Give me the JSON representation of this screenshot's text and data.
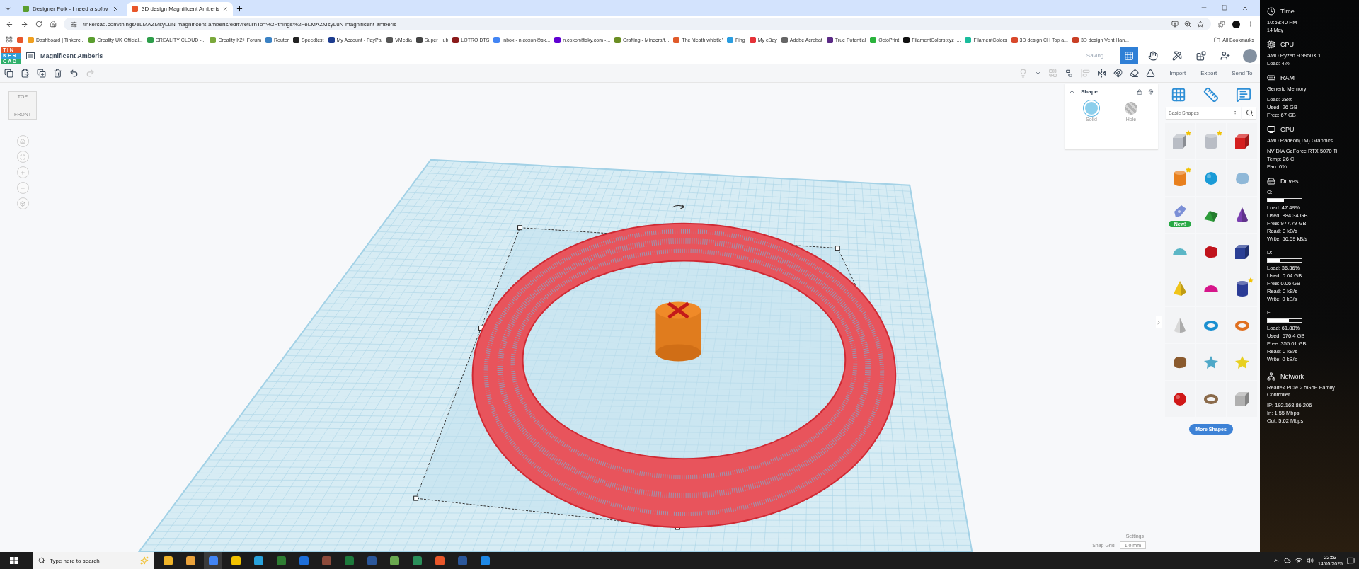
{
  "browser": {
    "tabs": [
      {
        "title": "Designer Folk - I need a softw",
        "color": "#5a9e2f",
        "selected": false
      },
      {
        "title": "3D design Magnificent Amberis",
        "color": "#e8562a",
        "selected": true
      }
    ],
    "url": "tinkercad.com/things/eLMAZMsyLuN-magnificent-amberis/edit?returnTo=%2Fthings%2FeLMAZMsyLuN-magnificent-amberis",
    "bookmarks": [
      {
        "color": "#e8562a"
      },
      {
        "label": "Dashboard | Tinkerc...",
        "color": "#f0a020"
      },
      {
        "label": "Creality UK Official...",
        "color": "#5a9e2f"
      },
      {
        "label": "CREALITY CLOUD -...",
        "color": "#2e9e4a"
      },
      {
        "label": "Creality K2+ Forum",
        "color": "#7aa83a"
      },
      {
        "label": "Router",
        "color": "#3b82c4"
      },
      {
        "label": "Speedtest",
        "color": "#222222"
      },
      {
        "label": "My Account - PayPal",
        "color": "#1d3c8f"
      },
      {
        "label": "VMedia",
        "color": "#555555"
      },
      {
        "label": "Super Hub",
        "color": "#444444"
      },
      {
        "label": "LOTRO DTS",
        "color": "#8b1a1a"
      },
      {
        "label": "Inbox - n.coxon@sk...",
        "color": "#4285f4"
      },
      {
        "label": "n.coxon@sky.com -...",
        "color": "#6001d2"
      },
      {
        "label": "Crafting - Minecraft...",
        "color": "#6b8e23"
      },
      {
        "label": "The 'death whistle'",
        "color": "#e05a2a"
      },
      {
        "label": "Fing",
        "color": "#2a9de0"
      },
      {
        "label": "My eBay",
        "color": "#e53238"
      },
      {
        "label": "Adobe Acrobat",
        "color": "#666666"
      },
      {
        "label": "True Potential",
        "color": "#5b2a86"
      },
      {
        "label": "OctoPrint",
        "color": "#2ab33c"
      },
      {
        "label": "FilamentColors.xyz |...",
        "color": "#111111"
      },
      {
        "label": "FilamentColors",
        "color": "#1abc9c"
      },
      {
        "label": "3D design CH Top a...",
        "color": "#d9482b"
      },
      {
        "label": "3D design Vent Han...",
        "color": "#c93f25"
      }
    ],
    "all_bookmarks": "All Bookmarks"
  },
  "tinkercad": {
    "logo_rows": [
      "TIN",
      "KER",
      "CAD"
    ],
    "design_name": "Magnificent Amberis",
    "save_status": "Saving...",
    "modes": [
      {
        "kind": "grid",
        "selected": true
      },
      {
        "kind": "hand",
        "selected": false
      },
      {
        "kind": "pickaxe",
        "selected": false
      },
      {
        "kind": "bricks",
        "selected": false
      },
      {
        "kind": "add-user",
        "selected": false
      }
    ],
    "edit_tools": [
      {
        "kind": "copy",
        "disabled": false
      },
      {
        "kind": "paste",
        "disabled": false
      },
      {
        "kind": "duplicate",
        "disabled": false
      },
      {
        "kind": "delete",
        "disabled": false
      },
      {
        "kind": "undo",
        "disabled": false
      },
      {
        "kind": "redo",
        "disabled": true
      }
    ],
    "shape_tools": [
      {
        "kind": "light",
        "disabled": true
      },
      {
        "kind": "caret",
        "disabled": false
      },
      {
        "kind": "group",
        "disabled": true
      },
      {
        "kind": "ungroup",
        "disabled": false
      },
      {
        "kind": "align",
        "disabled": true
      },
      {
        "kind": "mirror",
        "disabled": false
      },
      {
        "kind": "magnet",
        "disabled": false
      },
      {
        "kind": "eraser",
        "disabled": false
      },
      {
        "kind": "triangle",
        "disabled": false
      }
    ],
    "actions": [
      "Import",
      "Export",
      "Send To"
    ],
    "view_cube": {
      "top": "TOP",
      "front": "FRONT"
    },
    "nav_buttons": [
      {
        "kind": "home"
      },
      {
        "kind": "fit"
      },
      {
        "kind": "zoom-in"
      },
      {
        "kind": "zoom-out"
      },
      {
        "kind": "perspective"
      }
    ],
    "shape_panel": {
      "title": "Shape",
      "options": [
        {
          "kind": "solid",
          "label": "Solid",
          "selected": true
        },
        {
          "kind": "hole",
          "label": "Hole",
          "selected": false
        }
      ]
    },
    "library": {
      "category": "Basic Shapes",
      "more": "More Shapes",
      "shapes": [
        {
          "kind": "box",
          "color": "#b9bdc5",
          "starred": true
        },
        {
          "kind": "cylinder",
          "color": "#b9bdc5",
          "starred": true
        },
        {
          "kind": "box",
          "color": "#d41f1f",
          "starred": false
        },
        {
          "kind": "cylinder",
          "color": "#e8801e",
          "starred": true
        },
        {
          "kind": "sphere",
          "color": "#1a9bd7",
          "starred": false
        },
        {
          "kind": "blob",
          "color": "#8fb8d8",
          "starred": false
        },
        {
          "kind": "pen",
          "color": "#7b8fd6",
          "starred": false,
          "badge": "New!"
        },
        {
          "kind": "wedge",
          "color": "#2d9c3a",
          "starred": false
        },
        {
          "kind": "cone",
          "color": "#7a3fb0",
          "starred": false
        },
        {
          "kind": "half-sphere",
          "color": "#5bb6c6",
          "starred": false
        },
        {
          "kind": "blob",
          "color": "#c0131c",
          "starred": false
        },
        {
          "kind": "box",
          "color": "#2a3f95",
          "starred": false
        },
        {
          "kind": "pyramid",
          "color": "#f0c419",
          "starred": false
        },
        {
          "kind": "half-sphere",
          "color": "#d6168a",
          "starred": false
        },
        {
          "kind": "cylinder",
          "color": "#2b3c96",
          "starred": true
        },
        {
          "kind": "cone",
          "color": "#d8d8d8",
          "starred": false
        },
        {
          "kind": "torus",
          "color": "#1a8fd0",
          "starred": false
        },
        {
          "kind": "torus",
          "color": "#e07020",
          "starred": false
        },
        {
          "kind": "blob",
          "color": "#8a5a2e",
          "starred": false
        },
        {
          "kind": "star",
          "color": "#4fa8c8",
          "starred": false
        },
        {
          "kind": "star",
          "color": "#e8d020",
          "starred": false
        },
        {
          "kind": "sphere",
          "color": "#d01818",
          "starred": false
        },
        {
          "kind": "torus",
          "color": "#8a6a4a",
          "starred": false
        },
        {
          "kind": "box",
          "color": "#b0b0b0",
          "starred": false
        }
      ]
    },
    "canvas": {
      "settings": "Settings",
      "snap_label": "Snap Grid",
      "snap_value": "1.0 mm"
    }
  },
  "system_monitor": {
    "sections": [
      {
        "kind": "time",
        "title": "Time",
        "groups": [
          [
            "10:53:40 PM",
            "14 May"
          ]
        ]
      },
      {
        "kind": "cpu",
        "title": "CPU",
        "groups": [
          [
            "AMD Ryzen 9 9950X 1",
            "Load: 4%"
          ]
        ]
      },
      {
        "kind": "ram",
        "title": "RAM",
        "groups": [
          [
            "Generic Memory"
          ],
          [
            "Load: 28%",
            "Used: 26 GB",
            "Free: 67 GB"
          ]
        ]
      },
      {
        "kind": "gpu",
        "title": "GPU",
        "groups": [
          [
            "AMD Radeon(TM) Graphics"
          ],
          [
            "NVIDIA GeForce RTX 5070 Ti",
            "Temp: 26 C",
            "Fan: 0%"
          ]
        ]
      },
      {
        "kind": "drives",
        "title": "Drives",
        "drives": [
          {
            "label": "C:",
            "level": 0.4749,
            "lines": [
              "Load: 47.49%",
              "Used: 884.34 GB",
              "Free: 977.79 GB",
              "Read: 0 kB/s",
              "Write: 56.59 kB/s"
            ]
          },
          {
            "label": "D:",
            "level": 0.3636,
            "lines": [
              "Load: 36.36%",
              "Used: 0.04 GB",
              "Free: 0.06 GB",
              "Read: 0 kB/s",
              "Write: 0 kB/s"
            ]
          },
          {
            "label": "F:",
            "level": 0.6188,
            "lines": [
              "Load: 61.88%",
              "Used: 576.4 GB",
              "Free: 355.01 GB",
              "Read: 0 kB/s",
              "Write: 0 kB/s"
            ]
          }
        ]
      },
      {
        "kind": "network",
        "title": "Network",
        "groups": [
          [
            "Realtek PCIe 2.5GbE Family Controller"
          ],
          [
            "IP: 192.168.86.206",
            "In: 1.55 Mbps",
            "Out: 5.62 Mbps"
          ]
        ]
      }
    ]
  },
  "taskbar": {
    "search_placeholder": "Type here to search",
    "time": "22:53",
    "date": "14/05/2025"
  }
}
